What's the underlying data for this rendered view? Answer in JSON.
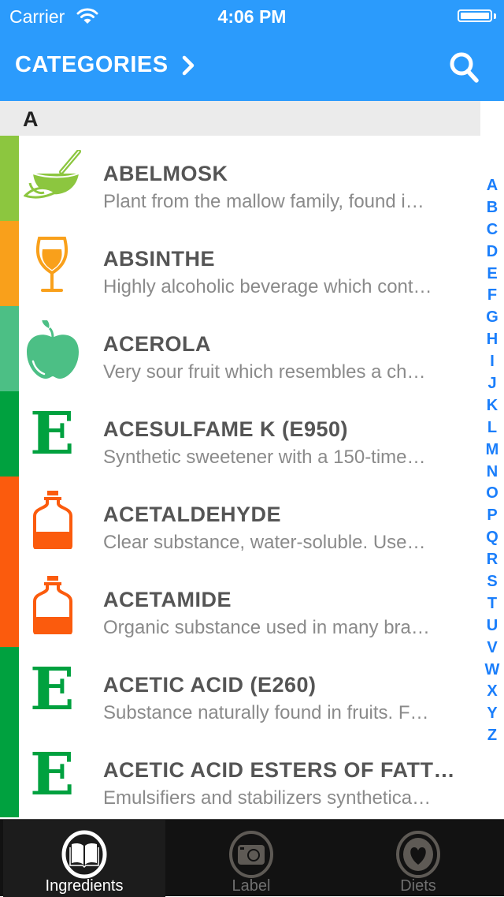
{
  "status_bar": {
    "carrier": "Carrier",
    "time": "4:06 PM",
    "battery_level": 1.0
  },
  "nav": {
    "title": "CATEGORIES",
    "title_icon": "chevron-right-icon",
    "search_icon": "search-icon"
  },
  "section": {
    "letter": "A"
  },
  "colors": {
    "header": "#2b9bfc",
    "index_letters": "#1a7efb",
    "plant": "#8cc63f",
    "beverage": "#f9a01b",
    "fruit": "#4cbf85",
    "additive": "#00a13f",
    "chemical": "#fb5b0d"
  },
  "items": [
    {
      "name": "ABELMOSK",
      "description": "Plant from the mallow family, found i…",
      "icon": "mortar-pestle-icon",
      "category_color": "#8cc63f"
    },
    {
      "name": "ABSINTHE",
      "description": "Highly alcoholic beverage which cont…",
      "icon": "glass-icon",
      "category_color": "#f9a01b"
    },
    {
      "name": "ACEROLA",
      "description": "Very sour fruit which resembles a ch…",
      "icon": "apple-icon",
      "category_color": "#4cbf85"
    },
    {
      "name": "ACESULFAME K (E950)",
      "description": "Synthetic sweetener with a 150-time…",
      "icon": "e-number-icon",
      "icon_glyph": "E",
      "category_color": "#00a13f"
    },
    {
      "name": "ACETALDEHYDE",
      "description": "Clear substance, water-soluble. Use…",
      "icon": "bottle-icon",
      "category_color": "#fb5b0d"
    },
    {
      "name": "ACETAMIDE",
      "description": "Organic substance used in many bra…",
      "icon": "bottle-icon",
      "category_color": "#fb5b0d"
    },
    {
      "name": "ACETIC ACID (E260)",
      "description": "Substance naturally found in fruits. F…",
      "icon": "e-number-icon",
      "icon_glyph": "E",
      "category_color": "#00a13f"
    },
    {
      "name": "ACETIC ACID ESTERS OF FATT…",
      "description": "Emulsifiers and stabilizers synthetica…",
      "icon": "e-number-icon",
      "icon_glyph": "E",
      "category_color": "#00a13f"
    }
  ],
  "index_letters": [
    "A",
    "B",
    "C",
    "D",
    "E",
    "F",
    "G",
    "H",
    "I",
    "J",
    "K",
    "L",
    "M",
    "N",
    "O",
    "P",
    "Q",
    "R",
    "S",
    "T",
    "U",
    "V",
    "W",
    "X",
    "Y",
    "Z"
  ],
  "tabs": [
    {
      "label": "Ingredients",
      "icon": "book-icon",
      "active": true
    },
    {
      "label": "Label",
      "icon": "camera-icon",
      "active": false
    },
    {
      "label": "Diets",
      "icon": "heart-icon",
      "active": false
    }
  ]
}
